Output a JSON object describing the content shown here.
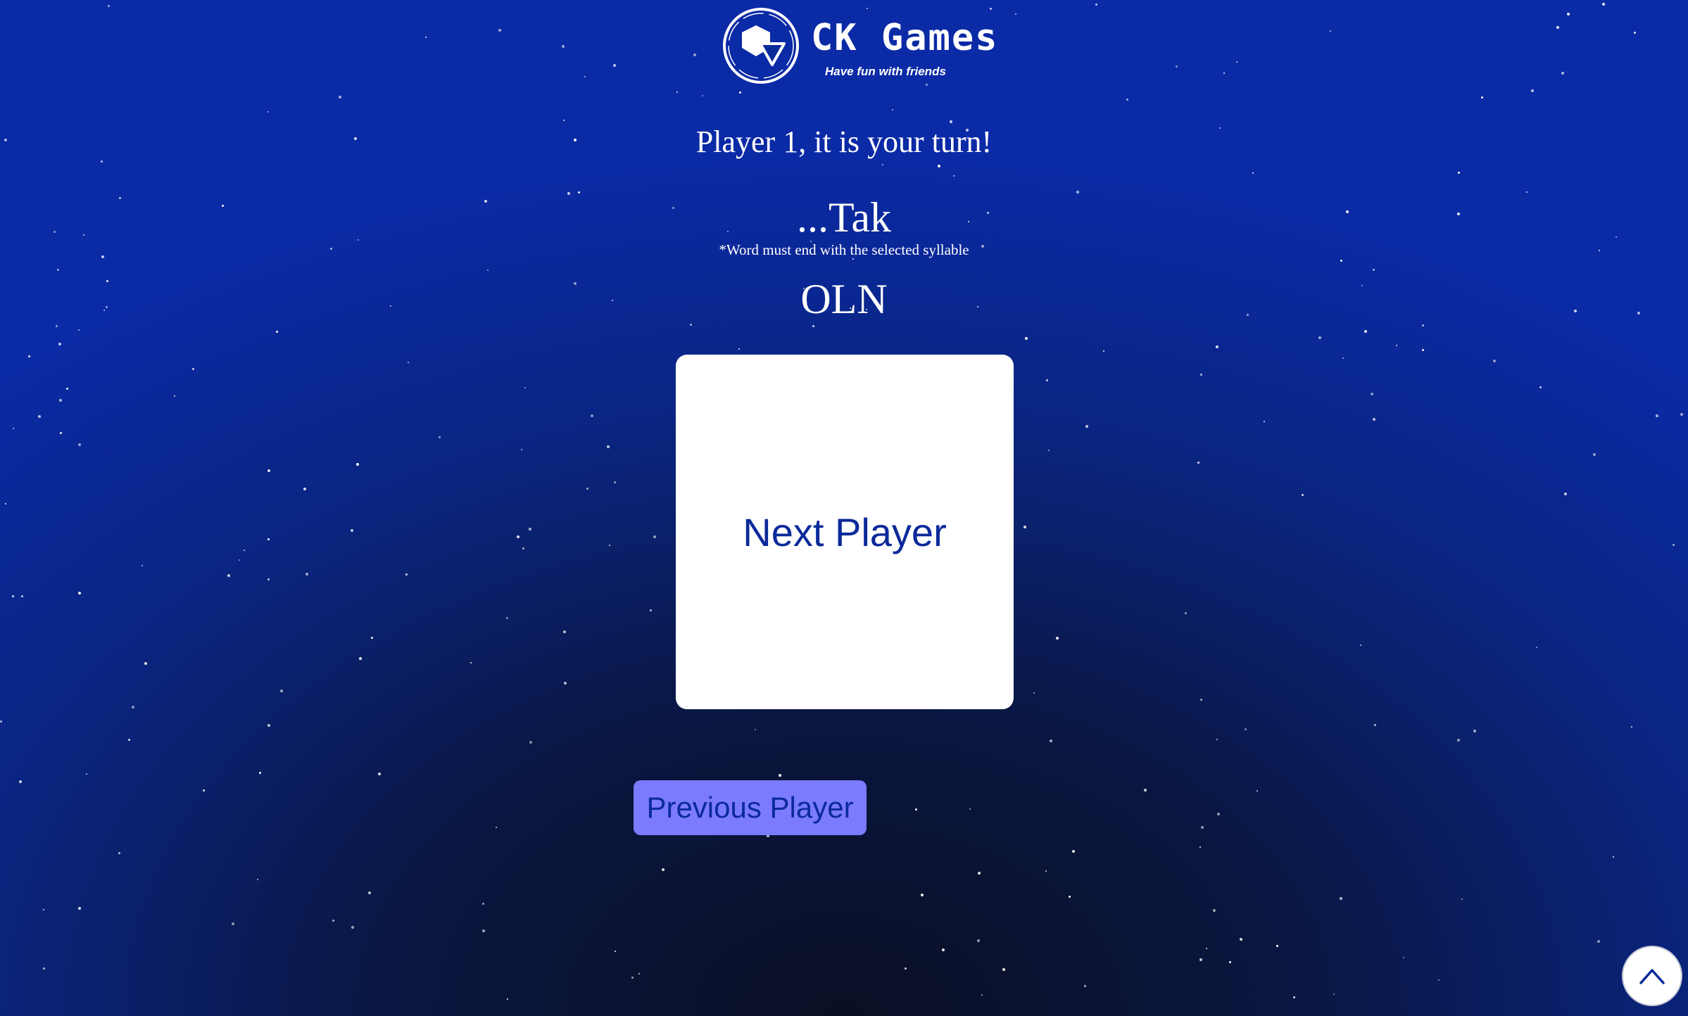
{
  "header": {
    "brand_name": "CK Games",
    "tagline": "Have fun with friends",
    "logo_icon": "ck-games-logo-icon"
  },
  "game": {
    "turn_message": "Player 1, it is your turn!",
    "syllable": "...Tak",
    "rule_note": "*Word must end with the selected syllable",
    "letters": "OLN"
  },
  "actions": {
    "next_player_label": "Next Player",
    "previous_player_label": "Previous Player",
    "scroll_top_icon": "chevron-up-icon"
  },
  "colors": {
    "background_top": "#0b2aa6",
    "background_bottom": "#0a0f24",
    "card_background": "#ffffff",
    "accent_text": "#0b2a9a",
    "previous_button": "#7b7bff"
  }
}
